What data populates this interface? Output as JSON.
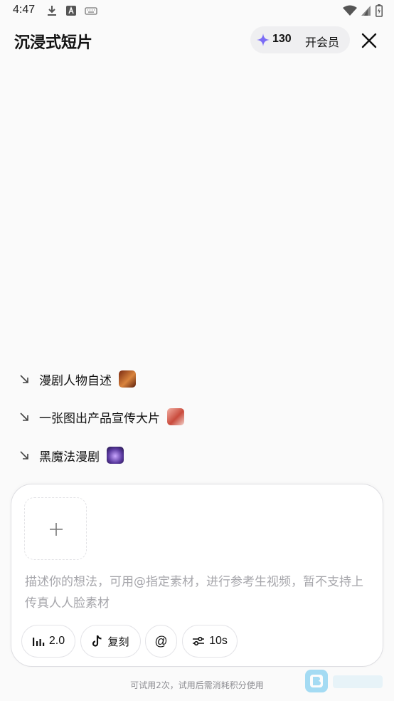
{
  "status_bar": {
    "time": "4:47",
    "left_icons": [
      "download-icon",
      "font-a-icon",
      "keyboard-icon"
    ],
    "right_icons": [
      "wifi-icon",
      "signal-icon",
      "battery-icon"
    ]
  },
  "header": {
    "title": "沉浸式短片",
    "credits": "130",
    "vip_label": "开会员",
    "close_icon": "close-icon"
  },
  "suggestions": [
    {
      "label": "漫剧人物自述",
      "thumb_color": "#b5532b"
    },
    {
      "label": "一张图出产品宣传大片",
      "thumb_color": "#d9756d"
    },
    {
      "label": "黑魔法漫剧",
      "thumb_color": "#5b3aa0"
    }
  ],
  "composer": {
    "upload_icon": "plus-icon",
    "placeholder": "描述你的想法，可用@指定素材，进行参考生视频，暂不支持上传真人人脸素材",
    "chips": {
      "model": "2.0",
      "replicate": "复刻",
      "mention": "@",
      "duration": "10s"
    }
  },
  "footer": {
    "note": "可试用2次，试用后需消耗积分使用"
  },
  "colors": {
    "accent_star": "#7b6cf6",
    "placeholder": "#a6a6ab"
  }
}
